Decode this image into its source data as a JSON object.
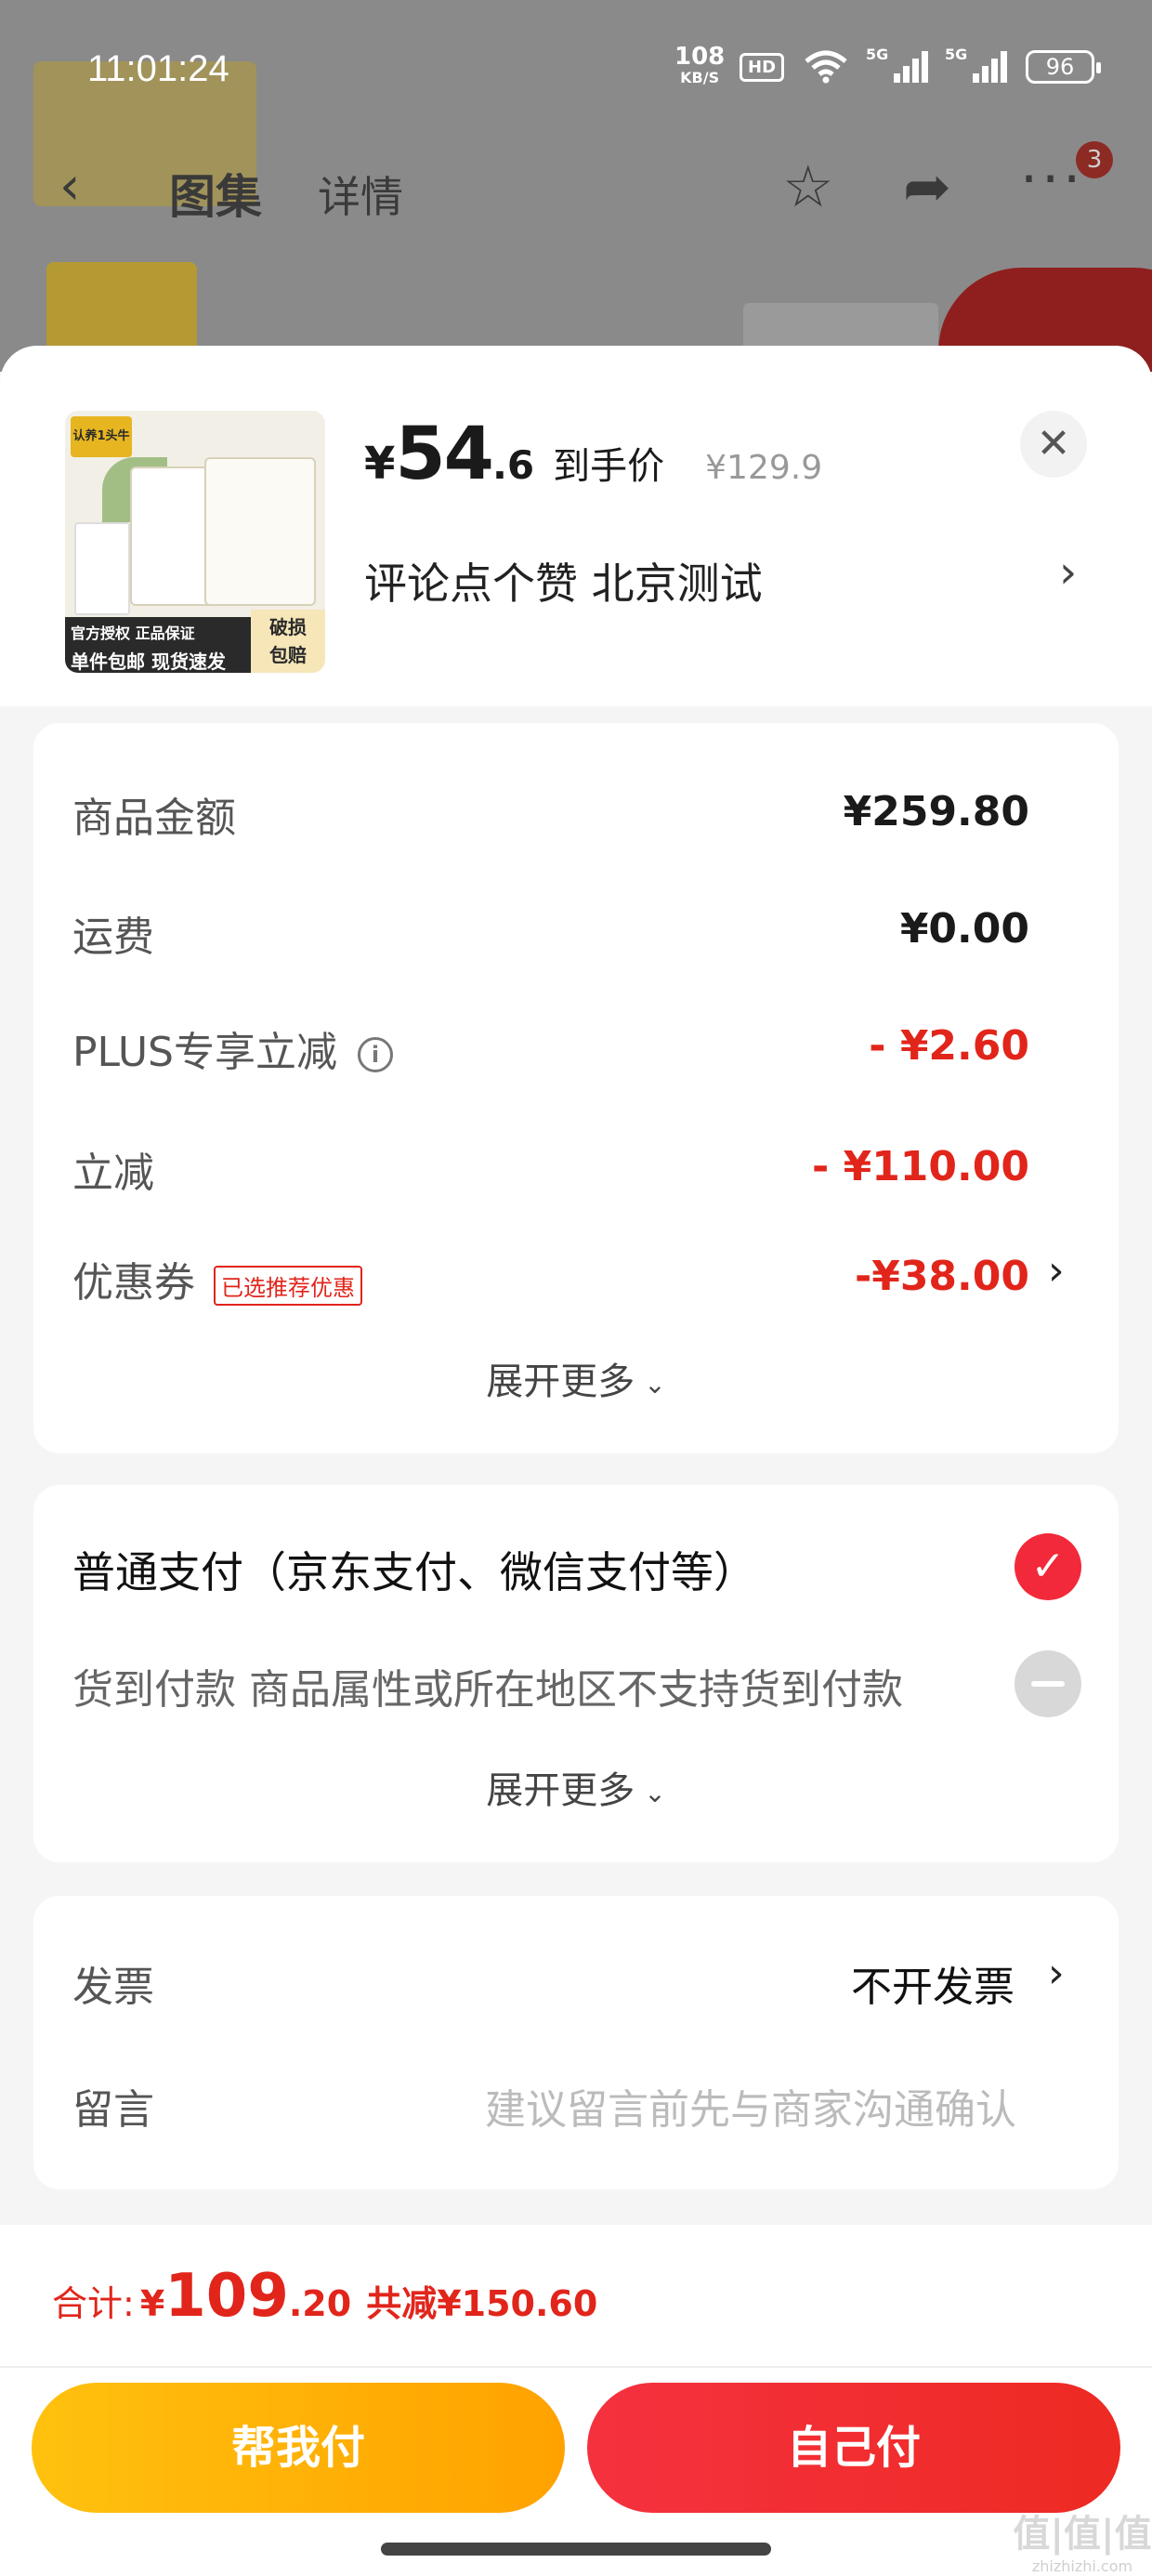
{
  "status_bar": {
    "time": "11:01:24",
    "net_speed_value": "108",
    "net_speed_unit": "KB/S",
    "hd_label": "HD",
    "sim1_label": "5G",
    "sim2_label": "5G",
    "battery": "96"
  },
  "background_page": {
    "tab_gallery": "图集",
    "tab_detail": "详情",
    "more_badge": "3"
  },
  "product": {
    "price_currency": "¥",
    "price_integer": "54",
    "price_decimal": ".6",
    "price_tag": "到手价",
    "original_price": "¥129.9",
    "shop_line": "评论点个赞  北京测试",
    "thumb_logo_text": "认养1头牛",
    "thumb_strip_line1": "官方授权 正品保证",
    "thumb_strip_line2": "单件包邮 现货速发",
    "thumb_seal_line1": "破损",
    "thumb_seal_line2": "包赔"
  },
  "summary": {
    "rows": [
      {
        "label": "商品金额",
        "value": "¥259.80"
      },
      {
        "label": "运费",
        "value": "¥0.00"
      },
      {
        "label": "PLUS专享立减",
        "value": "- ¥2.60"
      },
      {
        "label": "立减",
        "value": "- ¥110.00"
      },
      {
        "label": "优惠券",
        "value": "-¥38.00",
        "tag": "已选推荐优惠"
      }
    ],
    "expand_label": "展开更多"
  },
  "payment": {
    "option_normal": "普通支付（京东支付、微信支付等）",
    "option_cod": "货到付款 商品属性或所在地区不支持货到付款",
    "expand_label": "展开更多"
  },
  "extras": {
    "invoice_label": "发票",
    "invoice_value": "不开发票",
    "message_label": "留言",
    "message_placeholder": "建议留言前先与商家沟通确认"
  },
  "footer": {
    "total_label": "合计:",
    "total_currency": "¥",
    "total_integer": "109",
    "total_decimal": ".20",
    "total_saved": "共减¥150.60",
    "btn_help_pay": "帮我付",
    "btn_self_pay": "自己付",
    "watermark": "值|值|值",
    "watermark_sub": "zhizhizhi.com"
  },
  "colors": {
    "accent_red": "#e1251b",
    "help_button": "#ffb300",
    "self_button": "#f2293a"
  }
}
